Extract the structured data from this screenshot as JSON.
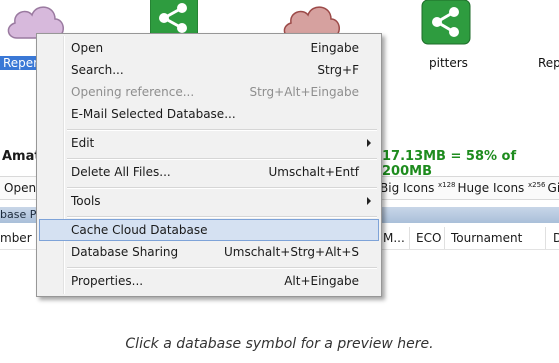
{
  "databases": [
    {
      "icon": "cloud-icon",
      "color": "#c8a8cf",
      "label": "Reperto",
      "selected": true
    },
    {
      "icon": "share-icon",
      "color": "#2e9c3f",
      "label": ""
    },
    {
      "icon": "cloud-icon",
      "color": "#c9908f",
      "label": ""
    },
    {
      "icon": "share-icon",
      "color": "#2e9c3f",
      "label": "pitters"
    },
    {
      "icon": "share-icon",
      "color": "#2e9c3f",
      "label": "Rep"
    }
  ],
  "info": {
    "title": "Amat",
    "usage": "17.13MB = 58% of 200MB"
  },
  "toolbar": {
    "open": "Open",
    "big_icons": "Big Icons",
    "huge_prefix": "x128",
    "huge_icons": "Huge Icons",
    "gi_prefix": "x256",
    "gi": "Gi"
  },
  "preview_strip": "base Pr",
  "columns": {
    "c1": "mber",
    "c2": "M...",
    "c3": "ECO",
    "c4": "Tournament",
    "c5": "D"
  },
  "menu": {
    "open": "Open",
    "open_sc": "Eingabe",
    "search": "Search...",
    "search_sc": "Strg+F",
    "opening_ref": "Opening reference...",
    "opening_ref_sc": "Strg+Alt+Eingabe",
    "email": "E-Mail Selected Database...",
    "edit": "Edit",
    "delete": "Delete All Files...",
    "delete_sc": "Umschalt+Entf",
    "tools": "Tools",
    "cache": "Cache Cloud Database",
    "sharing": "Database Sharing",
    "sharing_sc": "Umschalt+Strg+Alt+S",
    "properties": "Properties...",
    "properties_sc": "Alt+Eingabe"
  },
  "hint": "Click a database symbol for a preview here."
}
